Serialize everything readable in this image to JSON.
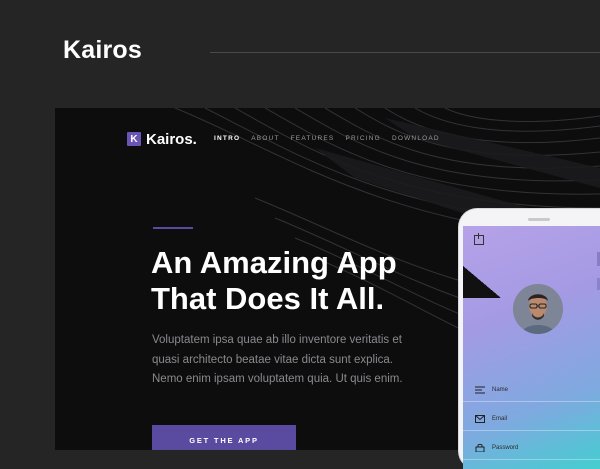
{
  "outer": {
    "title": "Kairos"
  },
  "site": {
    "logo_letter": "K",
    "logo_text": "Kairos.",
    "nav": [
      "INTRO",
      "ABOUT",
      "FEATURES",
      "PRICING",
      "DOWNLOAD"
    ],
    "headline_line1": "An Amazing App",
    "headline_line2": "That Does It All.",
    "lede": "Voluptatem ipsa quae ab illo inventore veritatis et quasi architecto beatae vitae dicta sunt explica. Nemo enim ipsam voluptatem quia. Ut quis enim.",
    "cta_label": "GET THE APP"
  },
  "phone": {
    "fields": [
      {
        "label": "Name",
        "icon": "menu-icon"
      },
      {
        "label": "Email",
        "icon": "mail-icon"
      },
      {
        "label": "Password",
        "icon": "lock-icon"
      }
    ]
  },
  "colors": {
    "accent": "#5a4aa0",
    "background": "#252525",
    "hero_background": "#0d0d0e"
  }
}
